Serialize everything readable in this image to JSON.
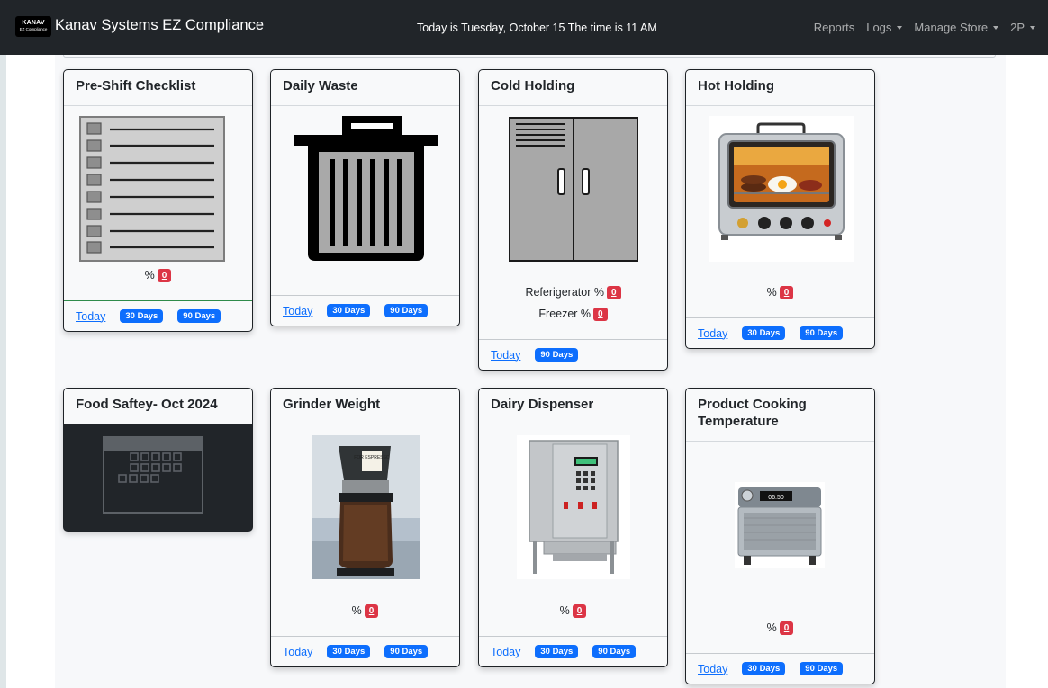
{
  "navbar": {
    "logo_line1": "KANAV",
    "logo_line2": "EZ Compliance",
    "brand": "Kanav Systems EZ Compliance",
    "datetime": "Today is Tuesday, October 15  The time is 11 AM",
    "menu": [
      "Reports",
      "Logs",
      "Manage Store",
      "2P"
    ]
  },
  "cards": {
    "preshift": {
      "title": "Pre-Shift Checklist",
      "metric_label": "%",
      "metric_value": "0",
      "today": "Today",
      "d30": "30 Days",
      "d90": "90 Days"
    },
    "waste": {
      "title": "Daily Waste",
      "today": "Today",
      "d30": "30 Days",
      "d90": "90 Days"
    },
    "cold": {
      "title": "Cold Holding",
      "fridge_label": "Referigerator %",
      "fridge_value": "0",
      "freezer_label": "Freezer %",
      "freezer_value": "0",
      "today": "Today",
      "d90": "90 Days"
    },
    "hot": {
      "title": "Hot Holding",
      "metric_label": "%",
      "metric_value": "0",
      "today": "Today",
      "d30": "30 Days",
      "d90": "90 Days"
    },
    "food": {
      "title": "Food Saftey- Oct 2024"
    },
    "grinder": {
      "title": "Grinder Weight",
      "metric_label": "%",
      "metric_value": "0",
      "today": "Today",
      "d30": "30 Days",
      "d90": "90 Days"
    },
    "dairy": {
      "title": "Dairy Dispenser",
      "metric_label": "%",
      "metric_value": "0",
      "today": "Today",
      "d30": "30 Days",
      "d90": "90 Days"
    },
    "cooking": {
      "title": "Product Cooking Temperature",
      "metric_label": "%",
      "metric_value": "0",
      "oven_display": "06:50",
      "today": "Today",
      "d30": "30 Days",
      "d90": "90 Days"
    }
  },
  "grinder_label": "FOR ESPRESSO"
}
